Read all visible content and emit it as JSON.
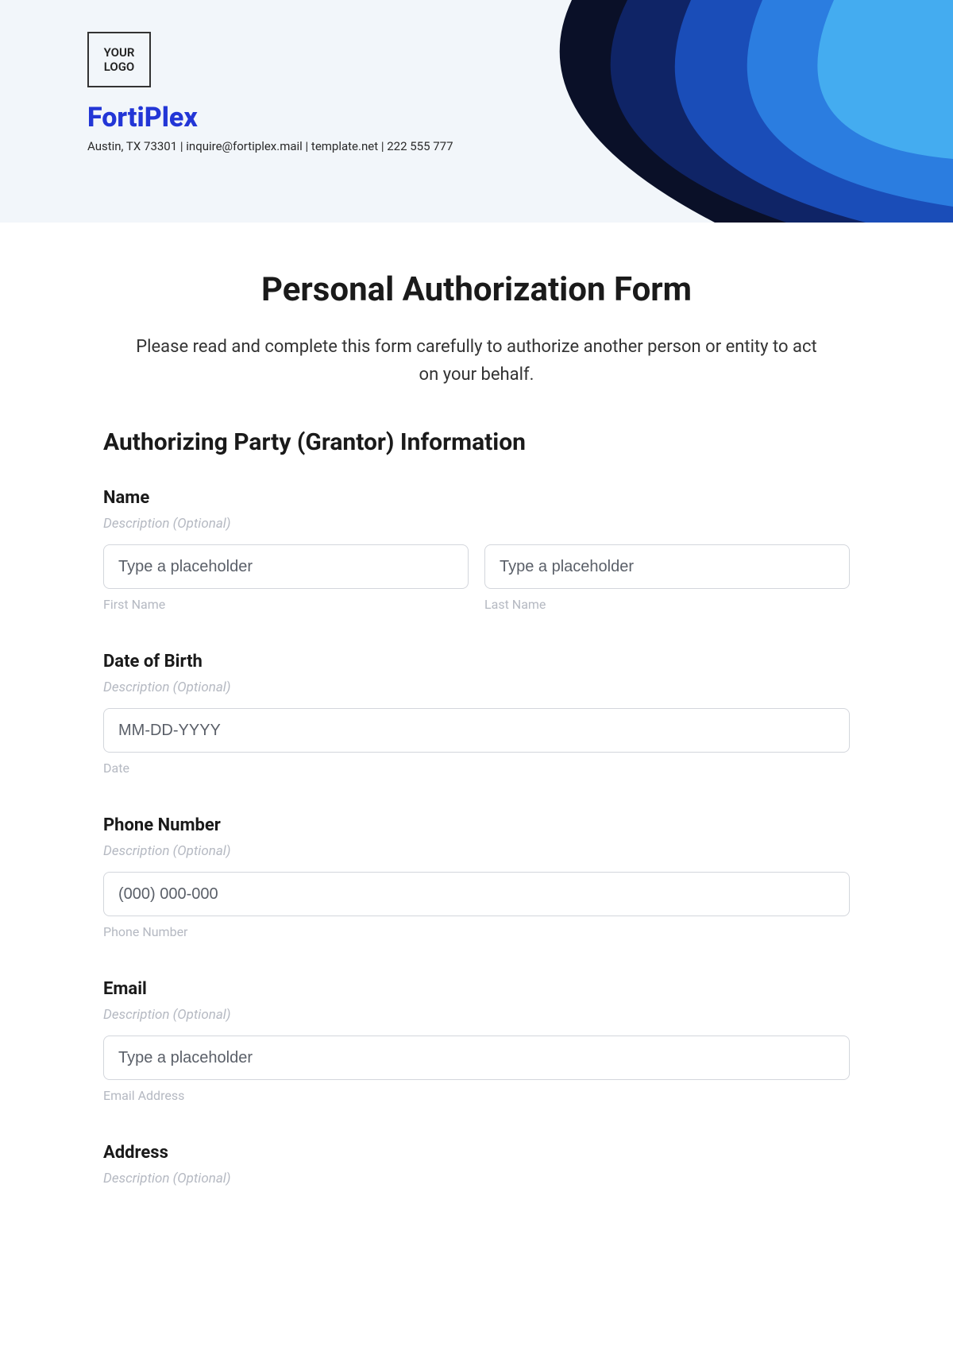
{
  "header": {
    "logo_text": "YOUR LOGO",
    "company_name": "FortiPlex",
    "contact_line": "Austin, TX 73301 | inquire@fortiplex.mail | template.net | 222 555 777"
  },
  "form": {
    "title": "Personal Authorization Form",
    "instruction": "Please read and complete this form carefully to authorize another person or entity to act on your behalf.",
    "section_heading": "Authorizing Party (Grantor) Information",
    "name": {
      "label": "Name",
      "description": "Description (Optional)",
      "first_placeholder": "Type a placeholder",
      "first_sublabel": "First Name",
      "last_placeholder": "Type a placeholder",
      "last_sublabel": "Last Name"
    },
    "dob": {
      "label": "Date of Birth",
      "description": "Description (Optional)",
      "placeholder": "MM-DD-YYYY",
      "sublabel": "Date"
    },
    "phone": {
      "label": "Phone Number",
      "description": "Description (Optional)",
      "placeholder": "(000) 000-000",
      "sublabel": "Phone Number"
    },
    "email": {
      "label": "Email",
      "description": "Description (Optional)",
      "placeholder": "Type a placeholder",
      "sublabel": "Email Address"
    },
    "address": {
      "label": "Address",
      "description": "Description (Optional)"
    }
  }
}
